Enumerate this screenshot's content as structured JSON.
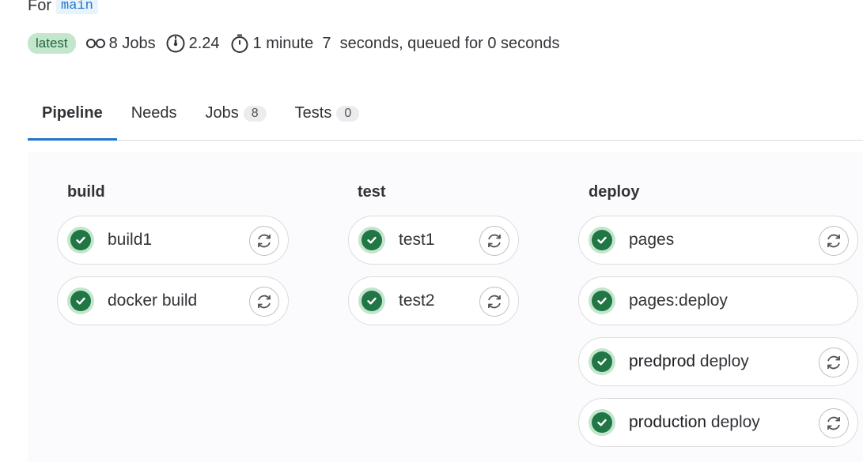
{
  "header": {
    "for_label": "For",
    "branch": "main",
    "badge": "latest",
    "jobs_text": "8 Jobs",
    "duration_text": "2.24",
    "time_text": "1 minute  7  seconds, queued for 0 seconds",
    "icons": [
      "pipeline-icon",
      "gauge-icon",
      "timer-icon"
    ]
  },
  "tabs": [
    {
      "label": "Pipeline",
      "count": null,
      "active": true
    },
    {
      "label": "Needs",
      "count": null,
      "active": false
    },
    {
      "label": "Jobs",
      "count": "8",
      "active": false
    },
    {
      "label": "Tests",
      "count": "0",
      "active": false
    }
  ],
  "stages": [
    {
      "title": "build",
      "jobs": [
        {
          "name": "build1",
          "status": "success",
          "retry": true
        },
        {
          "name": "docker build",
          "status": "success",
          "retry": true
        }
      ]
    },
    {
      "title": "test",
      "jobs": [
        {
          "name": "test1",
          "status": "success",
          "retry": true
        },
        {
          "name": "test2",
          "status": "success",
          "retry": true
        }
      ]
    },
    {
      "title": "deploy",
      "jobs": [
        {
          "name": "pages",
          "status": "success",
          "retry": true
        },
        {
          "name": "pages:deploy",
          "status": "success",
          "retry": false
        },
        {
          "name_parts": [
            "predprod",
            " deploy"
          ],
          "status": "success",
          "retry": true
        },
        {
          "name_parts": [
            "production",
            " deploy"
          ],
          "status": "success",
          "retry": true
        }
      ]
    }
  ],
  "colors": {
    "success_bg": "#c3e6cd",
    "success_fg": "#217645",
    "active_tab": "#1f75cb",
    "branch_text": "#1f75cb"
  }
}
